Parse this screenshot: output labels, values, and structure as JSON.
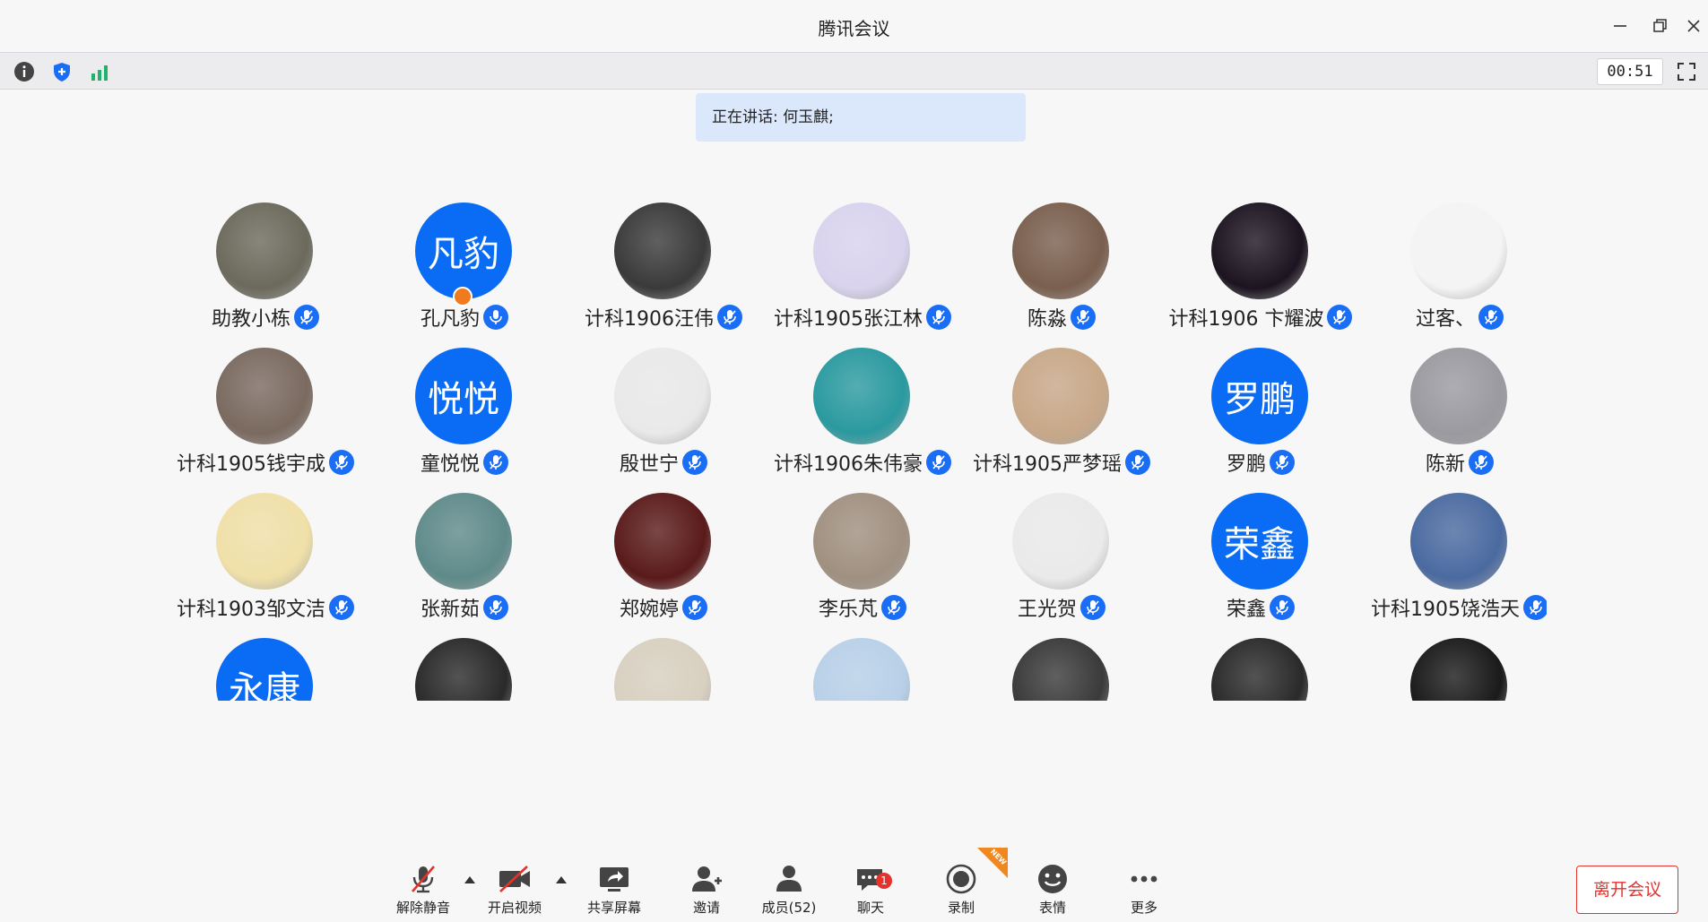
{
  "window": {
    "title": "腾讯会议"
  },
  "status": {
    "timer": "00:51"
  },
  "speaking": {
    "text": "正在讲话: 何玉麒;"
  },
  "participants": [
    {
      "name": "助教小栋",
      "avatar": "photo",
      "color": "#6c6a5c"
    },
    {
      "name": "孔凡豹",
      "avatar": "text",
      "text": "凡豹",
      "host": true
    },
    {
      "name": "计科1906汪伟",
      "avatar": "photo",
      "color": "#3a3a3a"
    },
    {
      "name": "计科1905张江林",
      "avatar": "photo",
      "color": "#d9d3ee"
    },
    {
      "name": "陈淼",
      "avatar": "photo",
      "color": "#7a5f4e"
    },
    {
      "name": "计科1906  卞耀波",
      "avatar": "photo",
      "color": "#1c1420"
    },
    {
      "name": "过客、",
      "avatar": "photo",
      "color": "#f4f4f4"
    },
    {
      "name": "计科1905钱宇成",
      "avatar": "photo",
      "color": "#7a6a60"
    },
    {
      "name": "童悦悦",
      "avatar": "text",
      "text": "悦悦"
    },
    {
      "name": "殷世宁",
      "avatar": "photo",
      "color": "#e9e9e9"
    },
    {
      "name": "计科1906朱伟豪",
      "avatar": "photo",
      "color": "#2a9aa0"
    },
    {
      "name": "计科1905严梦瑶",
      "avatar": "photo",
      "color": "#c8a888"
    },
    {
      "name": "罗鹏",
      "avatar": "text",
      "text": "罗鹏"
    },
    {
      "name": "陈新",
      "avatar": "photo",
      "color": "#9a9aa0"
    },
    {
      "name": "计科1903邹文洁",
      "avatar": "photo",
      "color": "#f0e0a8"
    },
    {
      "name": "张新茹",
      "avatar": "photo",
      "color": "#5f8a8a"
    },
    {
      "name": "郑婉婷",
      "avatar": "photo",
      "color": "#5a1a1a"
    },
    {
      "name": "李乐芃",
      "avatar": "photo",
      "color": "#a09080"
    },
    {
      "name": "王光贺",
      "avatar": "photo",
      "color": "#eaeaea"
    },
    {
      "name": "荣鑫",
      "avatar": "text",
      "text": "荣鑫"
    },
    {
      "name": "计科1905饶浩天",
      "avatar": "photo",
      "color": "#4a6aa0"
    },
    {
      "name": "",
      "avatar": "text",
      "text": "永康"
    },
    {
      "name": "",
      "avatar": "photo",
      "color": "#2a2a2a"
    },
    {
      "name": "",
      "avatar": "photo",
      "color": "#d8d0c0"
    },
    {
      "name": "",
      "avatar": "photo",
      "color": "#b8d0e8"
    },
    {
      "name": "",
      "avatar": "photo",
      "color": "#3a3a3a"
    },
    {
      "name": "",
      "avatar": "photo",
      "color": "#2a2a2a"
    },
    {
      "name": "",
      "avatar": "photo",
      "color": "#1a1a1a"
    }
  ],
  "toolbar": {
    "unmute": "解除静音",
    "video": "开启视频",
    "share": "共享屏幕",
    "invite": "邀请",
    "members": "成员(52)",
    "chat": "聊天",
    "chat_badge": "1",
    "record": "录制",
    "new_tag": "NEW",
    "reactions": "表情",
    "more": "更多",
    "leave": "离开会议"
  }
}
